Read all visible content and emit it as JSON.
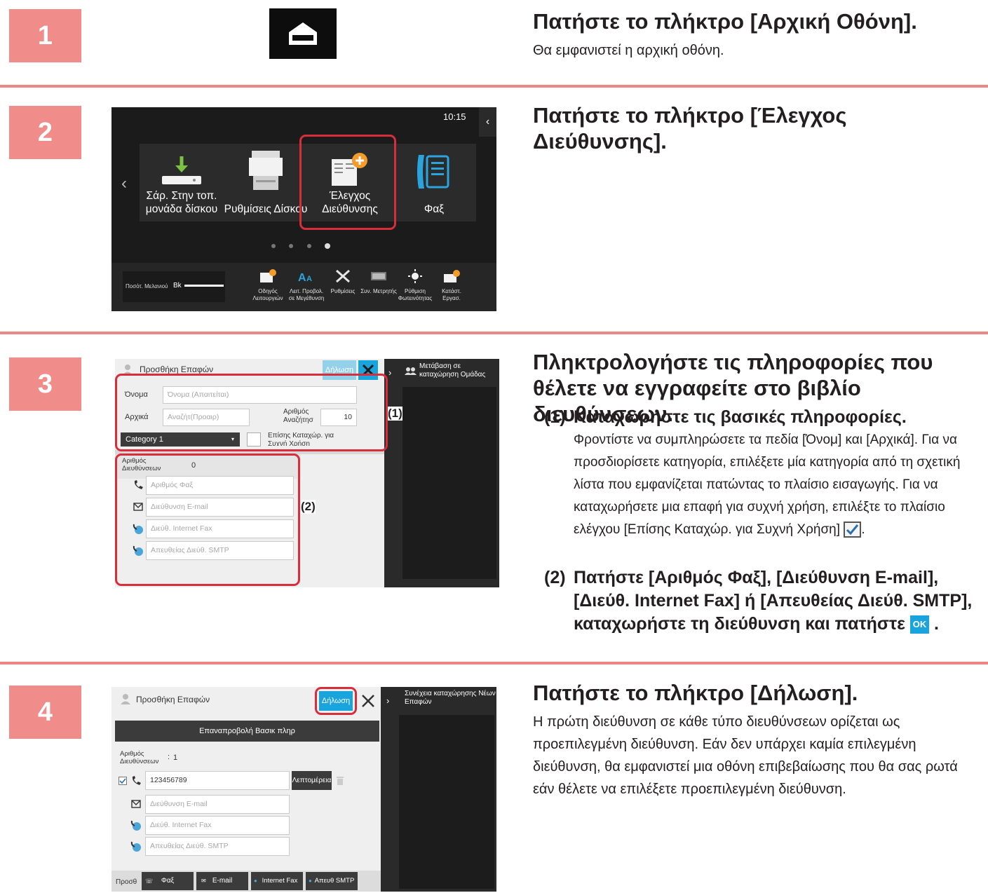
{
  "steps": [
    {
      "num": "1",
      "heading": "Πατήστε το πλήκτρο [Αρχική Οθόνη].",
      "text": "Θα εμφανιστεί η αρχική οθόνη."
    },
    {
      "num": "2",
      "heading": "Πατήστε το πλήκτρο [Έλεγχος Διεύθυνσης].",
      "panel": {
        "clock": "10:15",
        "tiles": [
          {
            "label": "Σάρ. Στην τοπ. μονάδα δίσκου",
            "icon": "download-icon"
          },
          {
            "label": "Ρυθμίσεις Δίσκου",
            "icon": "printer-icon"
          },
          {
            "label": "Έλεγχος Διεύθυνσης",
            "icon": "address-book-add-icon"
          },
          {
            "label": "Φαξ",
            "icon": "fax-icon"
          }
        ],
        "ink_label": "Ποσότ. Μελανιού",
        "ink_color": "Bk",
        "bottom": [
          {
            "label": "Οδηγός Λειτουργιών",
            "icon": "guide-icon"
          },
          {
            "label": "Λειτ. Προβολ. σε Μεγέθυνση",
            "icon": "magnify-text-icon"
          },
          {
            "label": "Ρυθμίσεις",
            "icon": "tools-icon"
          },
          {
            "label": "Συν. Μετρητής",
            "icon": "counter-icon"
          },
          {
            "label": "Ρύθμιση Φωτεινότητας",
            "icon": "brightness-icon"
          },
          {
            "label": "Κατάστ. Εργασ.",
            "icon": "job-status-icon"
          }
        ]
      }
    },
    {
      "num": "3",
      "heading": "Πληκτρολογήστε τις πληροφορίες που θέλετε να εγγραφείτε στο βιβλίο διευθύνσεων.",
      "sub1_num": "(1)",
      "sub1_heading": "Καταχωρήστε τις βασικές πληροφορίες.",
      "sub1_text_a": "Φροντίστε να συμπληρώσετε τα πεδία [Όνομ] και [Αρχικά]. Για να προσδιορίσετε κατηγορία, επιλέξετε μία κατηγορία από τη σχετική λίστα που εμφανίζεται πατώντας το πλαίσιο εισαγωγής. Για να καταχωρήσετε μια επαφή για συχνή χρήση, επιλέξτε το πλαίσιο ελέγχου [Επίσης Καταχώρ. για Συχνή Χρήση]",
      "sub1_text_b": ".",
      "sub2_num": "(2)",
      "sub2_heading": "Πατήστε [Αριθμός Φαξ], [Διεύθυνση E-mail], [Διεύθ. Internet Fax] ή [Απευθείας Διεύθ. SMTP], καταχωρήστε τη διεύθυνση και πατήστε",
      "sub2_end": ".",
      "ok_label": "OK",
      "panel": {
        "title": "Προσθήκη Επαφών",
        "register_btn": "Δήλωση",
        "side_link": "Μετάβαση σε καταχώρηση Ομάδας",
        "name_label": "Όνομα",
        "name_placeholder": "Όνομα (Απαιτείται)",
        "initial_label": "Αρχικά",
        "initial_placeholder": "Αναζήτ(Προαιρ)",
        "search_no_label": "Αριθμός Αναζήτησ",
        "search_no_value": "10",
        "category": "Category 1",
        "frequent_label": "Επίσης Καταχώρ. για Συχνή Χρήση",
        "addr_count_label": "Αριθμός Διευθύνσεων",
        "addr_count_value": "0",
        "fields": [
          "Αριθμός Φαξ",
          "Διεύθυνση E-mail",
          "Διεύθ. Internet Fax",
          "Απευθείας Διεύθ. SMTP"
        ],
        "callout1": "(1)",
        "callout2": "(2)"
      }
    },
    {
      "num": "4",
      "heading": "Πατήστε το πλήκτρο [Δήλωση].",
      "text": "Η πρώτη διεύθυνση σε κάθε τύπο διευθύνσεων ορίζεται ως προεπιλεγμένη διεύθυνση. Εάν δεν υπάρχει καμία επιλεγμένη διεύθυνση, θα εμφανιστεί μια οθόνη επιβεβαίωσης που θα σας ρωτά εάν θέλετε να επιλέξετε προεπιλεγμένη διεύθυνση.",
      "panel": {
        "title": "Προσθήκη Επαφών",
        "register_btn": "Δήλωση",
        "side_link": "Συνέχεια καταχώρησης Νέων Επαφών",
        "restore_btn": "Επαναπροβολή Βασικ πληρ",
        "addr_count_label": "Αριθμός Διευθύνσεων",
        "addr_count_value": "1",
        "fax_value": "123456789",
        "details_btn": "Λεπτομέρεια",
        "fields": [
          "Διεύθυνση E-mail",
          "Διεύθ. Internet Fax",
          "Απευθείας Διεύθ. SMTP"
        ],
        "add_label": "Προσθ",
        "add_buttons": [
          "Φαξ",
          "E-mail",
          "Internet Fax",
          "Απευθ SMTP"
        ]
      }
    }
  ]
}
